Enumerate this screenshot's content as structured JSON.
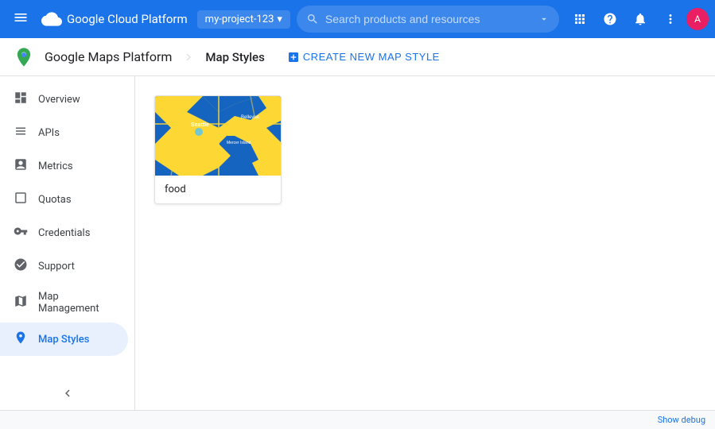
{
  "topbar": {
    "menu_icon": "☰",
    "title": "Google Cloud Platform",
    "project_name": "my-project-123",
    "search_placeholder": "Search products and resources",
    "search_dropdown_icon": "▾",
    "icons": {
      "grid": "⊞",
      "help": "?",
      "bell": "🔔",
      "more": "⋮"
    },
    "avatar_letter": "A"
  },
  "subheader": {
    "brand": "Google Maps Platform",
    "page_title": "Map Styles",
    "create_button_label": "CREATE NEW MAP STYLE",
    "create_icon": "+"
  },
  "sidebar": {
    "items": [
      {
        "id": "overview",
        "label": "Overview",
        "icon": "⊙",
        "active": false
      },
      {
        "id": "apis",
        "label": "APIs",
        "icon": "≡",
        "active": false
      },
      {
        "id": "metrics",
        "label": "Metrics",
        "icon": "📊",
        "active": false
      },
      {
        "id": "quotas",
        "label": "Quotas",
        "icon": "▭",
        "active": false
      },
      {
        "id": "credentials",
        "label": "Credentials",
        "icon": "🔑",
        "active": false
      },
      {
        "id": "support",
        "label": "Support",
        "icon": "👤",
        "active": false
      },
      {
        "id": "map-management",
        "label": "Map Management",
        "icon": "▦",
        "active": false
      },
      {
        "id": "map-styles",
        "label": "Map Styles",
        "icon": "◎",
        "active": true
      }
    ],
    "collapse_icon": "«"
  },
  "content": {
    "map_styles": [
      {
        "id": "food",
        "label": "food",
        "has_thumbnail": true
      }
    ]
  },
  "debug_bar": {
    "label": "Show debug"
  },
  "colors": {
    "active_blue": "#1a73e8",
    "active_bg": "#e8f0fe",
    "map_blue": "#1565c0",
    "map_yellow": "#fdd835"
  }
}
